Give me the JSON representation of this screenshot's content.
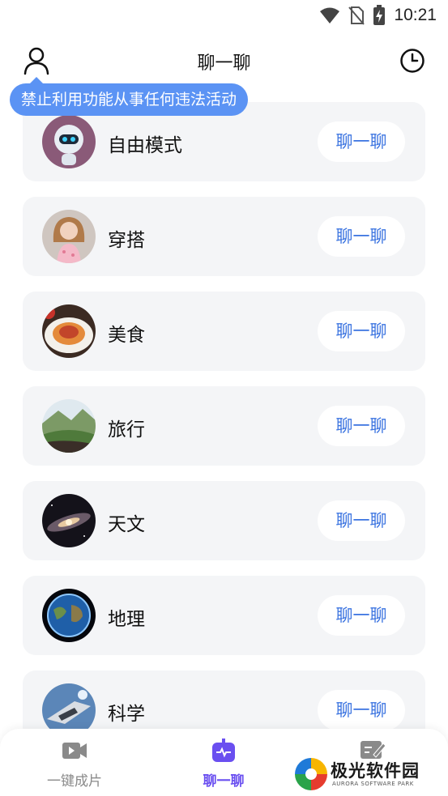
{
  "status_bar": {
    "time": "10:21"
  },
  "header": {
    "title": "聊一聊"
  },
  "tooltip": {
    "text": "禁止利用功能从事任何违法活动"
  },
  "topics": [
    {
      "label": "自由模式",
      "button": "聊一聊",
      "icon": "robot-avatar"
    },
    {
      "label": "穿搭",
      "button": "聊一聊",
      "icon": "fashion-girl-avatar"
    },
    {
      "label": "美食",
      "button": "聊一聊",
      "icon": "pasta-avatar"
    },
    {
      "label": "旅行",
      "button": "聊一聊",
      "icon": "landscape-avatar"
    },
    {
      "label": "天文",
      "button": "聊一聊",
      "icon": "galaxy-avatar"
    },
    {
      "label": "地理",
      "button": "聊一聊",
      "icon": "earth-avatar"
    },
    {
      "label": "科学",
      "button": "聊一聊",
      "icon": "spaceship-avatar"
    }
  ],
  "bottom_nav": [
    {
      "label": "一键成片",
      "icon": "video-camera-icon",
      "active": false
    },
    {
      "label": "聊一聊",
      "icon": "robot-icon",
      "active": true
    },
    {
      "label": "",
      "icon": "edit-note-icon",
      "active": false
    }
  ],
  "watermark": {
    "title": "极光软件园",
    "subtitle": "AURORA SOFTWARE PARK"
  },
  "colors": {
    "accent": "#6a4ff0",
    "button_text": "#3a73e0",
    "tooltip_bg": "#5b93f4",
    "card_bg": "#f4f5f7"
  }
}
